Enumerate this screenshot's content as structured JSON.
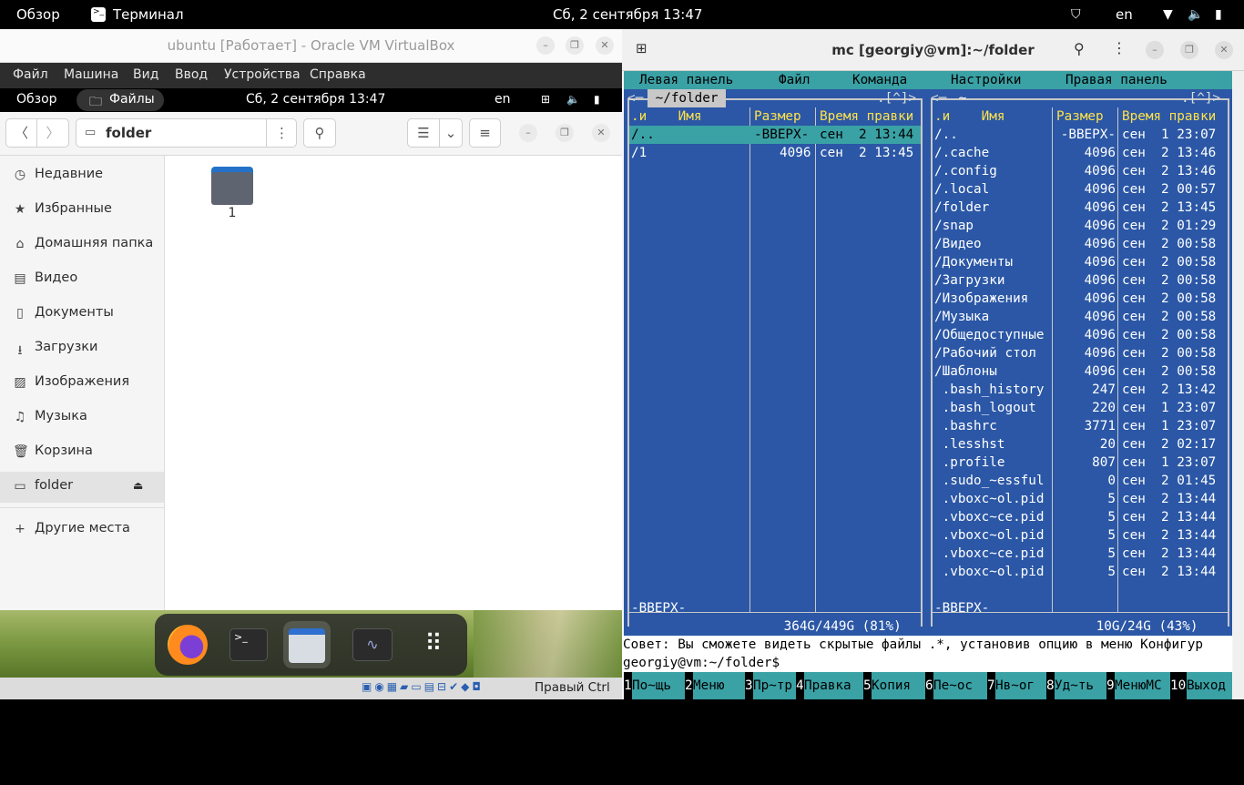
{
  "topbar": {
    "overview": "Обзор",
    "app": "Терминал",
    "clock": "Сб, 2 сентября  13:47",
    "lang": "en"
  },
  "vbox": {
    "title": "ubuntu [Работает] - Oracle VM VirtualBox",
    "menu": [
      "Файл",
      "Машина",
      "Вид",
      "Ввод",
      "Устройства",
      "Справка"
    ],
    "guestbar": {
      "overview": "Обзор",
      "app": "Файлы",
      "clock": "Сб, 2 сентября  13:47",
      "lang": "en"
    },
    "path": "folder",
    "sidebar": [
      "Недавние",
      "Избранные",
      "Домашняя папка",
      "Видео",
      "Документы",
      "Загрузки",
      "Изображения",
      "Музыка",
      "Корзина",
      "folder",
      "Другие места"
    ],
    "folder_item": "1",
    "host_key": "Правый Ctrl"
  },
  "terminal": {
    "title": "mc [georgiy@vm]:~/folder",
    "menubar": [
      "Левая панель",
      "Файл",
      "Команда",
      "Настройки",
      "Правая панель"
    ],
    "left": {
      "path": " ~/folder ",
      "header": {
        "name": ".и    Имя",
        "size": "Размер",
        "time": "Время правки"
      },
      "rows": [
        {
          "name": "/..",
          "size": "-ВВЕРХ-",
          "time": "сен  2 13:44"
        },
        {
          "name": "/1",
          "size": "4096",
          "time": "сен  2 13:45"
        }
      ],
      "status": "-ВВЕРХ-",
      "disk": " 364G/449G (81%) "
    },
    "right": {
      "path": " ~ ",
      "header": {
        "name": ".и    Имя",
        "size": "Размер",
        "time": "Время правки"
      },
      "rows": [
        {
          "name": "/..",
          "size": "-ВВЕРХ-",
          "time": "сен  1 23:07"
        },
        {
          "name": "/.cache",
          "size": "4096",
          "time": "сен  2 13:46"
        },
        {
          "name": "/.config",
          "size": "4096",
          "time": "сен  2 13:46"
        },
        {
          "name": "/.local",
          "size": "4096",
          "time": "сен  2 00:57"
        },
        {
          "name": "/folder",
          "size": "4096",
          "time": "сен  2 13:45"
        },
        {
          "name": "/snap",
          "size": "4096",
          "time": "сен  2 01:29"
        },
        {
          "name": "/Видео",
          "size": "4096",
          "time": "сен  2 00:58"
        },
        {
          "name": "/Документы",
          "size": "4096",
          "time": "сен  2 00:58"
        },
        {
          "name": "/Загрузки",
          "size": "4096",
          "time": "сен  2 00:58"
        },
        {
          "name": "/Изображения",
          "size": "4096",
          "time": "сен  2 00:58"
        },
        {
          "name": "/Музыка",
          "size": "4096",
          "time": "сен  2 00:58"
        },
        {
          "name": "/Общедоступные",
          "size": "4096",
          "time": "сен  2 00:58"
        },
        {
          "name": "/Рабочий стол",
          "size": "4096",
          "time": "сен  2 00:58"
        },
        {
          "name": "/Шаблоны",
          "size": "4096",
          "time": "сен  2 00:58"
        },
        {
          "name": " .bash_history",
          "size": "247",
          "time": "сен  2 13:42"
        },
        {
          "name": " .bash_logout",
          "size": "220",
          "time": "сен  1 23:07"
        },
        {
          "name": " .bashrc",
          "size": "3771",
          "time": "сен  1 23:07"
        },
        {
          "name": " .lesshst",
          "size": "20",
          "time": "сен  2 02:17"
        },
        {
          "name": " .profile",
          "size": "807",
          "time": "сен  1 23:07"
        },
        {
          "name": " .sudo_~essful",
          "size": "0",
          "time": "сен  2 01:45"
        },
        {
          "name": " .vboxc~ol.pid",
          "size": "5",
          "time": "сен  2 13:44"
        },
        {
          "name": " .vboxc~ce.pid",
          "size": "5",
          "time": "сен  2 13:44"
        },
        {
          "name": " .vboxc~ol.pid",
          "size": "5",
          "time": "сен  2 13:44"
        },
        {
          "name": " .vboxc~ce.pid",
          "size": "5",
          "time": "сен  2 13:44"
        },
        {
          "name": " .vboxc~ol.pid",
          "size": "5",
          "time": "сен  2 13:44"
        }
      ],
      "status": "-ВВЕРХ-",
      "disk": " 10G/24G (43%) "
    },
    "hint": "Совет: Вы сможете видеть скрытые файлы .*, установив опцию в меню Конфигур",
    "prompt": "georgiy@vm:~/folder$",
    "fkeys": [
      {
        "n": "1",
        "l": "По~щь"
      },
      {
        "n": "2",
        "l": "Меню"
      },
      {
        "n": "3",
        "l": "Пр~тр"
      },
      {
        "n": "4",
        "l": "Правка"
      },
      {
        "n": "5",
        "l": "Копия"
      },
      {
        "n": "6",
        "l": "Пе~ос"
      },
      {
        "n": "7",
        "l": "Нв~ог"
      },
      {
        "n": "8",
        "l": "Уд~ть"
      },
      {
        "n": "9",
        "l": "МенюMC"
      },
      {
        "n": "10",
        "l": "Выход"
      }
    ]
  }
}
